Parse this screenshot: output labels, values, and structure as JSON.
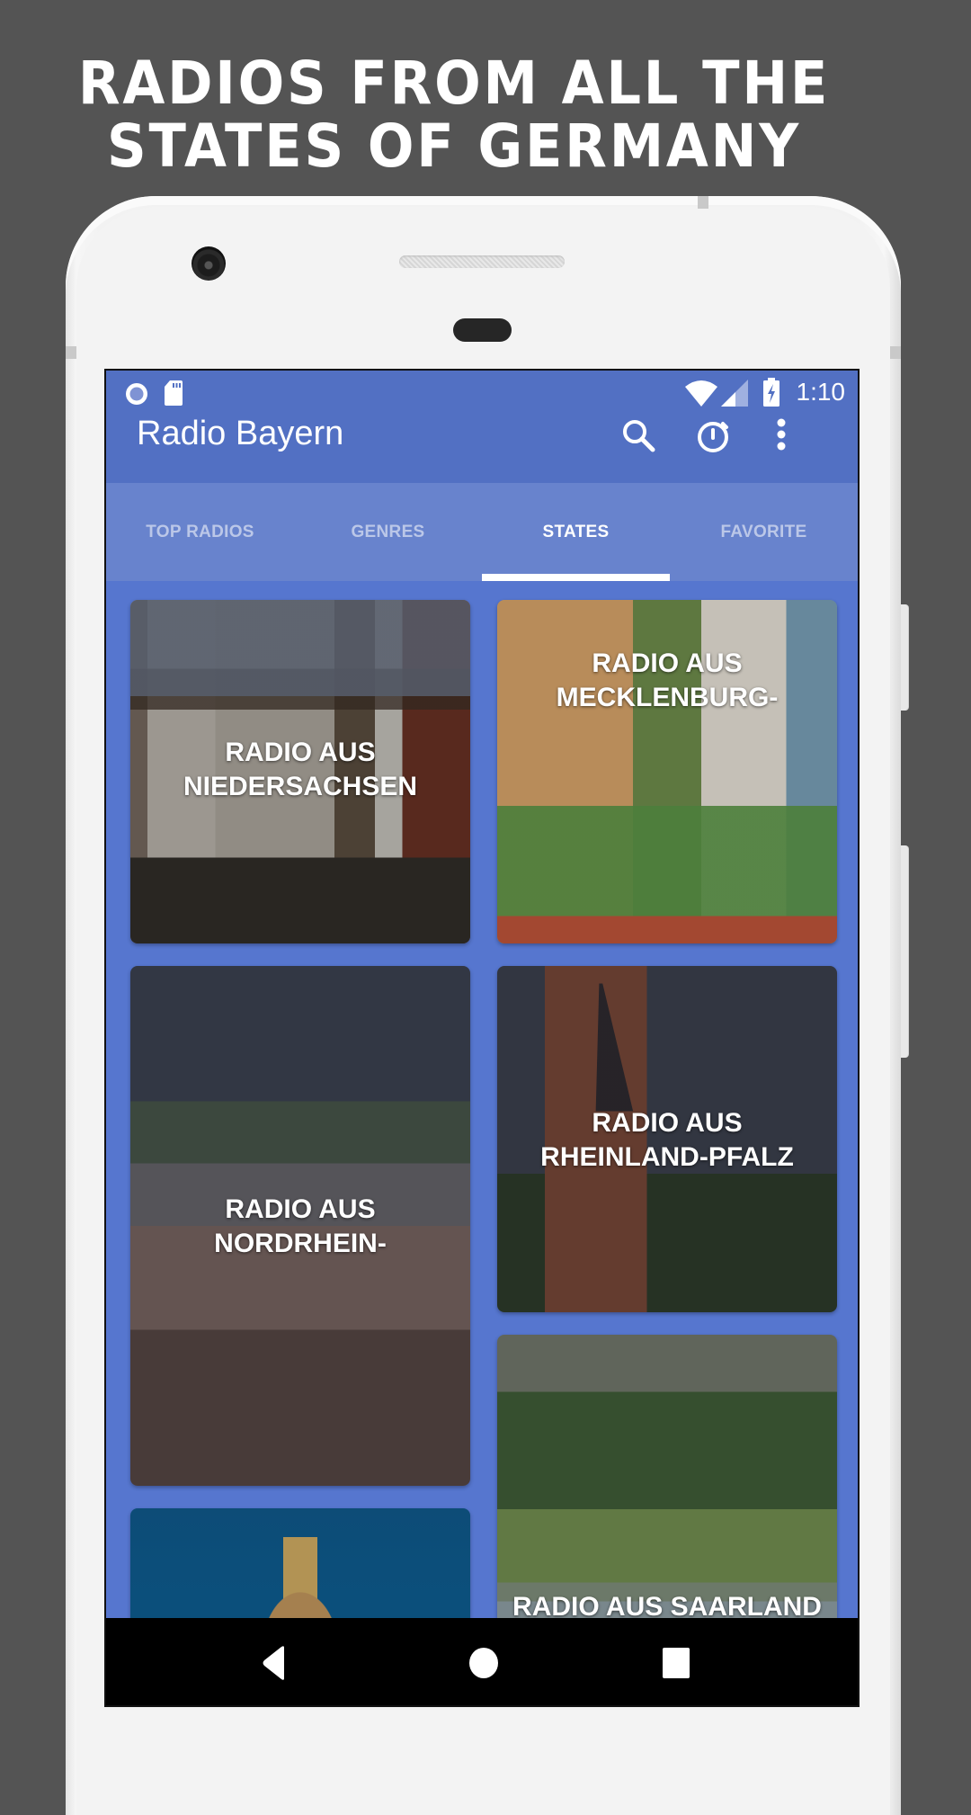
{
  "promo": {
    "headline_line1": "RADIOS FROM ALL THE",
    "headline_line2": "STATES OF GERMANY"
  },
  "status_bar": {
    "left_icons": [
      "record-circle-icon",
      "sd-card-icon"
    ],
    "right_icons": [
      "wifi-icon",
      "cell-signal-icon",
      "battery-charging-icon"
    ],
    "time": "1:10"
  },
  "app_bar": {
    "title": "Radio Bayern",
    "actions": [
      "search-icon",
      "timer-icon",
      "more-vert-icon"
    ]
  },
  "tabs": [
    {
      "label": "TOP RADIOS",
      "active": false
    },
    {
      "label": "GENRES",
      "active": false
    },
    {
      "label": "STATES",
      "active": true
    },
    {
      "label": "FAVORITE",
      "active": false
    }
  ],
  "cards": [
    {
      "line1": "RADIO AUS",
      "line2": "NIEDERSACHSEN"
    },
    {
      "line1": "RADIO AUS",
      "line2": "MECKLENBURG-"
    },
    {
      "line1": "RADIO AUS",
      "line2": "NORDRHEIN-"
    },
    {
      "line1": "RADIO AUS",
      "line2": "RHEINLAND-PFALZ"
    },
    {
      "line1": "",
      "line2": ""
    },
    {
      "line1": "RADIO AUS SAARLAND",
      "line2": ""
    }
  ],
  "nav_bar": [
    "back-icon",
    "home-icon",
    "recents-icon"
  ],
  "colors": {
    "background": "#545454",
    "app_bar": "#5270c3",
    "tab_bar": "#6883cd",
    "grid_background": "#5676cf",
    "tab_indicator": "#ffffff"
  }
}
